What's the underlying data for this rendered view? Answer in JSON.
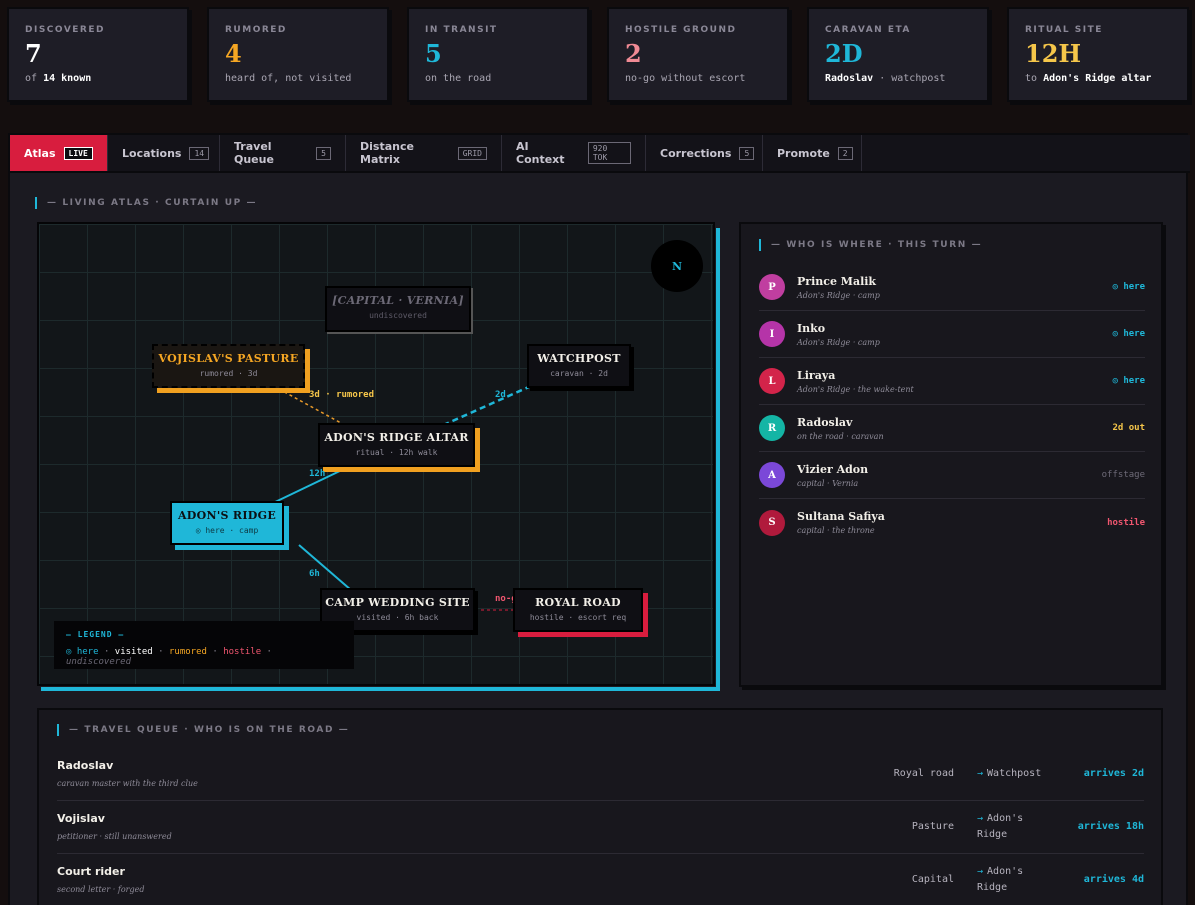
{
  "stats": [
    {
      "label": "DISCOVERED",
      "value": "7",
      "sub_pre": "of",
      "sub_bold": "14 known",
      "sub_post": "",
      "color": "#ffffff"
    },
    {
      "label": "RUMORED",
      "value": "4",
      "sub_pre": "heard of, not visited",
      "sub_bold": "",
      "sub_post": "",
      "color": "#f5a623"
    },
    {
      "label": "IN TRANSIT",
      "value": "5",
      "sub_pre": "on the road",
      "sub_bold": "",
      "sub_post": "",
      "color": "#1fb7d8"
    },
    {
      "label": "HOSTILE GROUND",
      "value": "2",
      "sub_pre": "no-go without escort",
      "sub_bold": "",
      "sub_post": "",
      "color": "#f08a94"
    },
    {
      "label": "CARAVAN ETA",
      "value": "2D",
      "sub_pre": "",
      "sub_bold": "Radoslav",
      "sub_post": "· watchpost",
      "color": "#1fb7d8"
    },
    {
      "label": "RITUAL SITE",
      "value": "12H",
      "sub_pre": "to",
      "sub_bold": "Adon's Ridge altar",
      "sub_post": "",
      "color": "#f5c64a"
    }
  ],
  "tabs": [
    {
      "label": "Atlas",
      "badge": "LIVE"
    },
    {
      "label": "Locations",
      "badge": "14"
    },
    {
      "label": "Travel Queue",
      "badge": "5"
    },
    {
      "label": "Distance Matrix",
      "badge": "GRID"
    },
    {
      "label": "AI Context",
      "badge": "920 TOK"
    },
    {
      "label": "Corrections",
      "badge": "5"
    },
    {
      "label": "Promote",
      "badge": "2"
    }
  ],
  "atlas": {
    "title": "— LIVING ATLAS · CURTAIN UP —",
    "compass": "N",
    "nodes": {
      "capital": {
        "title": "[CAPITAL · VERNIA]",
        "sub": "undiscovered"
      },
      "pasture": {
        "title": "VOJISLAV'S PASTURE",
        "sub": "rumored · 3d"
      },
      "watchpost": {
        "title": "WATCHPOST",
        "sub": "caravan · 2d"
      },
      "altar": {
        "title": "ADON'S RIDGE ALTAR",
        "sub": "ritual · 12h walk"
      },
      "ridge": {
        "title": "ADON'S RIDGE",
        "sub": "◎ here · camp"
      },
      "wedding": {
        "title": "CAMP WEDDING SITE",
        "sub": "visited · 6h back"
      },
      "royal": {
        "title": "ROYAL ROAD",
        "sub": "hostile · escort req"
      }
    },
    "edges": {
      "pasture_altar": "3d · rumored",
      "watch_altar": "2d",
      "ridge_altar": "12h",
      "ridge_wedding": "6h",
      "wedding_royal": "no-go"
    },
    "legend": {
      "title": "— LEGEND —",
      "here": "◎ here",
      "visited": "visited",
      "rumored": "rumored",
      "hostile": "hostile",
      "undiscovered": "undiscovered",
      "sep": "·"
    }
  },
  "who": {
    "title": "— WHO IS WHERE · THIS TURN —",
    "people": [
      {
        "initial": "P",
        "name": "Prince Malik",
        "loc": "Adon's Ridge · camp",
        "status": "◎ here",
        "status_color": "#1fb7d8",
        "avatar_color": "#c03ea0"
      },
      {
        "initial": "I",
        "name": "Inko",
        "loc": "Adon's Ridge · camp",
        "status": "◎ here",
        "status_color": "#1fb7d8",
        "avatar_color": "#b534a8"
      },
      {
        "initial": "L",
        "name": "Liraya",
        "loc": "Adon's Ridge · the wake-tent",
        "status": "◎ here",
        "status_color": "#1fb7d8",
        "avatar_color": "#d3244a"
      },
      {
        "initial": "R",
        "name": "Radoslav",
        "loc": "on the road · caravan",
        "status": "2d out",
        "status_color": "#f5c64a",
        "avatar_color": "#14b5a5"
      },
      {
        "initial": "A",
        "name": "Vizier Adon",
        "loc": "capital · Vernia",
        "status": "offstage",
        "status_color": "#6e6b78",
        "avatar_color": "#7b48d8"
      },
      {
        "initial": "S",
        "name": "Sultana Safiya",
        "loc": "capital · the throne",
        "status": "hostile",
        "status_color": "#f0566f",
        "avatar_color": "#b01a3c"
      }
    ]
  },
  "queue": {
    "title": "— TRAVEL QUEUE · WHO IS ON THE ROAD —",
    "rows": [
      {
        "name": "Radoslav",
        "note": "caravan master with the third clue",
        "from": "Royal road",
        "to": "Watchpost",
        "eta": "arrives 2d"
      },
      {
        "name": "Vojislav",
        "note": "petitioner · still unanswered",
        "from": "Pasture",
        "to": "Adon's Ridge",
        "eta": "arrives 18h"
      },
      {
        "name": "Court rider",
        "note": "second letter · forged",
        "from": "Capital",
        "to": "Adon's Ridge",
        "eta": "arrives 4d"
      }
    ]
  }
}
